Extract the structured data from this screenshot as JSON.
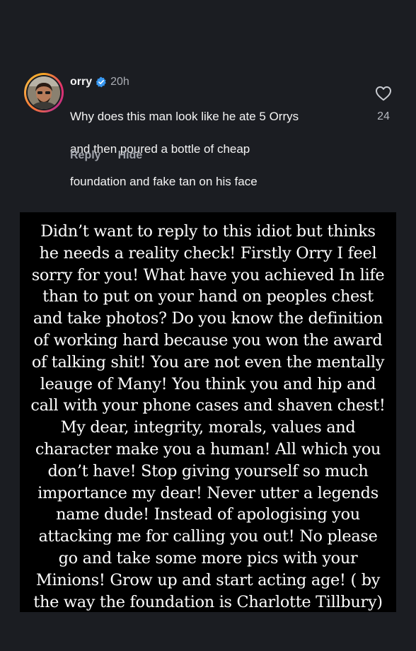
{
  "comment": {
    "username": "orry",
    "time": "20h",
    "lines": [
      "Why does this man look like he ate 5 Orrys",
      "and then poured a bottle of cheap",
      "foundation and fake tan on his face"
    ],
    "reply_label": "Reply",
    "hide_label": "Hide",
    "like_count": "24",
    "verified_color": "#3897f0"
  },
  "reply_panel": {
    "lines": [
      "Didn’t want to reply to this idiot but thinks",
      "he needs a reality check! Firstly Orry I feel",
      "sorry for you! What have you achieved In life",
      "than to put on your hand on peoples chest",
      "and take photos? Do you know the definition",
      "of working hard because you won the award",
      "of talking shit! You are not even the mentally",
      "leauge of Many! You think you and hip and",
      "call with your phone cases and shaven chest!",
      "My dear, integrity, morals, values and",
      "character make you a human! All which you",
      "don’t have! Stop giving yourself so much",
      "importance my dear! Never utter a legends",
      "name dude! Instead of apologising you",
      "attacking me for calling you out! No please",
      "go and take some more pics with your",
      "Minions! Grow up and start acting age! ( by",
      "the way the foundation is Charlotte Tillbury)"
    ]
  }
}
